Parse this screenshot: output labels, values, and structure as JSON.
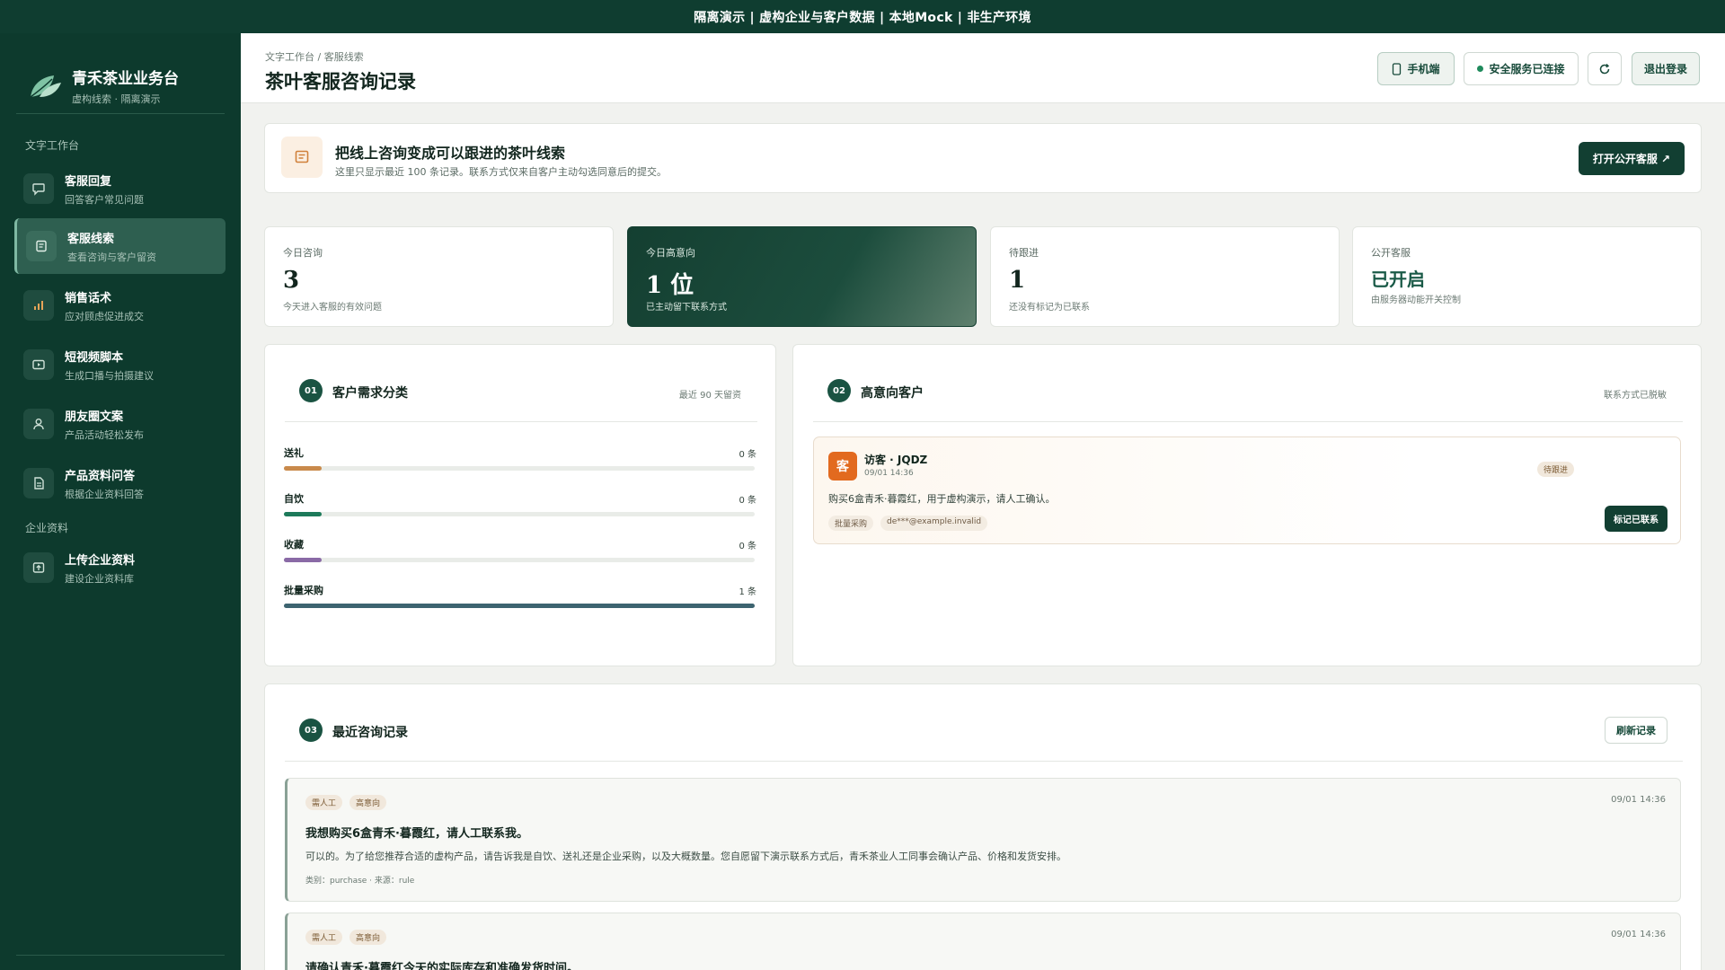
{
  "topbar": {
    "text": "隔离演示 | 虚构企业与客户数据 | 本地Mock | 非生产环境"
  },
  "brand": {
    "title": "青禾茶业业务台",
    "subtitle": "虚构线索 · 隔离演示"
  },
  "sidebar": {
    "section_workbench": "文字工作台",
    "section_company": "企业资料",
    "items": [
      {
        "title": "客服回复",
        "sub": "回答客户常见问题",
        "icon": "chat-bubble-icon"
      },
      {
        "title": "客服线索",
        "sub": "查看咨询与客户留资",
        "icon": "message-lines-icon"
      },
      {
        "title": "销售话术",
        "sub": "应对顾虑促进成交",
        "icon": "bar-chart-icon"
      },
      {
        "title": "短视频脚本",
        "sub": "生成口播与拍摄建议",
        "icon": "video-play-icon"
      },
      {
        "title": "朋友圈文案",
        "sub": "产品活动轻松发布",
        "icon": "user-icon"
      },
      {
        "title": "产品资料问答",
        "sub": "根据企业资料回答",
        "icon": "document-icon"
      },
      {
        "title": "上传企业资料",
        "sub": "建设企业资料库",
        "icon": "upload-box-icon"
      }
    ]
  },
  "header": {
    "breadcrumb": "文字工作台 / 客服线索",
    "title": "茶叶客服咨询记录",
    "mobile_label": "手机端",
    "secure_label": "安全服务已连接",
    "logout_label": "退出登录"
  },
  "banner": {
    "title": "把线上咨询变成可以跟进的茶叶线索",
    "desc": "这里只显示最近 100 条记录。联系方式仅来自客户主动勾选同意后的提交。",
    "button": "打开公开客服 ↗"
  },
  "stats": [
    {
      "label": "今日咨询",
      "value": "3",
      "note": "今天进入客服的有效问题"
    },
    {
      "label": "今日高意向",
      "value": "1 位",
      "note": "已主动留下联系方式"
    },
    {
      "label": "待跟进",
      "value": "1",
      "note": "还没有标记为已联系"
    },
    {
      "label": "公开客服",
      "value": "已开启",
      "note": "由服务器动能开关控制"
    }
  ],
  "needs_panel": {
    "num": "01",
    "title": "客户需求分类",
    "meta": "最近 90 天留资",
    "items": [
      {
        "label": "送礼",
        "count": "0 条",
        "fill": 0.08,
        "color": "#c98a4b"
      },
      {
        "label": "自饮",
        "count": "0 条",
        "fill": 0.08,
        "color": "#1d7a5a"
      },
      {
        "label": "收藏",
        "count": "0 条",
        "fill": 0.08,
        "color": "#8a6aa6"
      },
      {
        "label": "批量采购",
        "count": "1 条",
        "fill": 1.0,
        "color": "#3d6470"
      }
    ]
  },
  "leads_panel": {
    "num": "02",
    "title": "高意向客户",
    "meta": "联系方式已脱敏",
    "lead": {
      "avatar": "客",
      "name": "访客 · JQDZ",
      "time": "09/01 14:36",
      "status": "待跟进",
      "message": "购买6盒青禾·暮霞红，用于虚构演示，请人工确认。",
      "tag_category": "批量采购",
      "tag_contact": "de***@example.invalid",
      "action": "标记已联系"
    }
  },
  "records_panel": {
    "num": "03",
    "title": "最近咨询记录",
    "refresh": "刷新记录",
    "records": [
      {
        "tag1": "需人工",
        "tag2": "高意向",
        "time": "09/01 14:36",
        "question": "我想购买6盒青禾·暮霞红，请人工联系我。",
        "answer": "可以的。为了给您推荐合适的虚构产品，请告诉我是自饮、送礼还是企业采购，以及大概数量。您自愿留下演示联系方式后，青禾茶业人工同事会确认产品、价格和发货安排。",
        "meta": "类别：purchase · 来源：rule"
      },
      {
        "tag1": "需人工",
        "tag2": "高意向",
        "time": "09/01 14:36",
        "question": "请确认青禾·暮霞红今天的实际库存和准确发货时间。"
      }
    ]
  }
}
